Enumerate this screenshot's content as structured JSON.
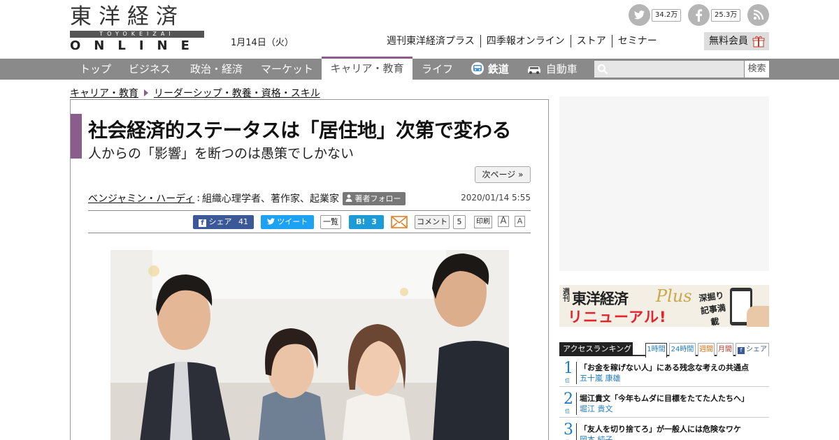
{
  "header": {
    "logo": {
      "kanji": "東洋経済",
      "roman": "TOYOKEIZAI",
      "online": "ONLINE"
    },
    "date": "1月14日（火）",
    "social": {
      "twitter_count": "34.2万",
      "facebook_count": "25.3万"
    },
    "top_links": [
      "週刊東洋経済プラス",
      "四季報オンライン",
      "ストア",
      "セミナー"
    ],
    "member_button": "無料会員"
  },
  "nav": {
    "items": [
      "トップ",
      "ビジネス",
      "政治・経済",
      "マーケット",
      "キャリア・教育",
      "ライフ",
      "鉄道",
      "自動車"
    ],
    "active": "キャリア・教育",
    "search_button": "検索",
    "search_placeholder": ""
  },
  "breadcrumb": [
    "キャリア・教育",
    "リーダーシップ・教養・資格・スキル"
  ],
  "article": {
    "title": "社会経済的ステータスは「居住地」次第で変わる",
    "subtitle": "人からの「影響」を断つのは愚策でしかない",
    "next_page": "次ページ »",
    "author": "ベンジャミン・ハーディ",
    "author_separator": ":",
    "author_role": "組織心理学者、著作家、起業家",
    "follow_label": "著者フォロー",
    "published": "2020/01/14 5:55",
    "share": {
      "facebook_label": "シェア",
      "facebook_count": "41",
      "twitter_label": "ツイート",
      "twitter_list": "一覧",
      "hatena_label": "B!",
      "hatena_count": "3",
      "comment_label": "コメント",
      "comment_count": "5",
      "print_label": "印刷",
      "font_large": "A",
      "font_small": "A"
    }
  },
  "sidebar": {
    "plus_banner": {
      "weekly": "週刊",
      "name": "東洋経済",
      "plus": "Plus",
      "renewal": "リニューアル!",
      "tag": "深掘り記事満載"
    },
    "ranking": {
      "title": "アクセスランキング",
      "tabs": [
        "1時間",
        "24時間",
        "週間",
        "月間",
        "シェア"
      ],
      "rank_suffix": "位",
      "items": [
        {
          "rank": "1",
          "title": "「お金を稼げない人」にある残念な考えの共通点",
          "author": "五十嵐 康雄"
        },
        {
          "rank": "2",
          "title": "堀江貴文「今年もムダに目標をたてた人たちへ」",
          "author": "堀江 貴文"
        },
        {
          "rank": "3",
          "title": "「友人を切り捨てろ」が一般人には危険なワケ",
          "author": "岡本 純子"
        }
      ]
    }
  },
  "colors": {
    "accent_purple": "#8a5d8e",
    "nav_gray": "#8a8a8a",
    "facebook": "#3b5998",
    "twitter": "#1da1f2",
    "hatena": "#1d9bd8",
    "rank_blue": "#1f7bbf"
  }
}
